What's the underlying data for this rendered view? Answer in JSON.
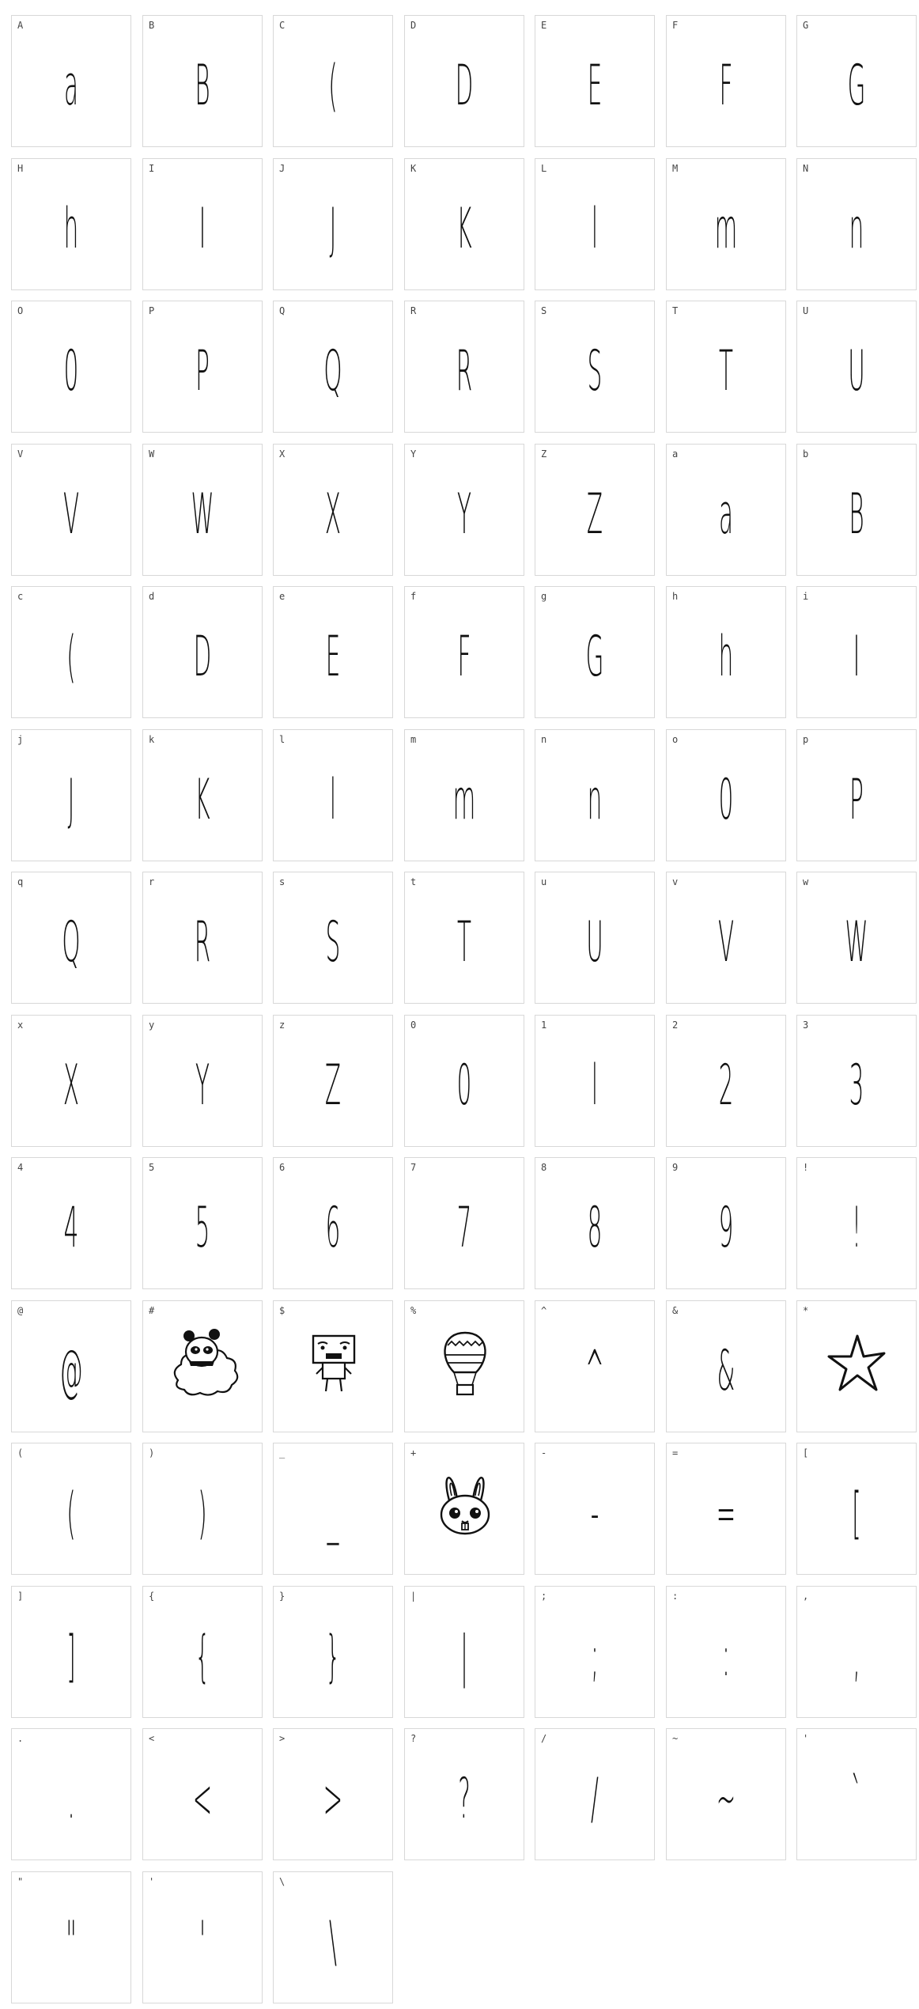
{
  "chars": [
    {
      "label": "A",
      "glyph": "a"
    },
    {
      "label": "B",
      "glyph": "B"
    },
    {
      "label": "C",
      "glyph": "("
    },
    {
      "label": "D",
      "glyph": "D"
    },
    {
      "label": "E",
      "glyph": "E"
    },
    {
      "label": "F",
      "glyph": "F"
    },
    {
      "label": "G",
      "glyph": "G"
    },
    {
      "label": "H",
      "glyph": "h"
    },
    {
      "label": "I",
      "glyph": "I"
    },
    {
      "label": "J",
      "glyph": "J"
    },
    {
      "label": "K",
      "glyph": "K"
    },
    {
      "label": "L",
      "glyph": "l"
    },
    {
      "label": "M",
      "glyph": "m"
    },
    {
      "label": "N",
      "glyph": "n"
    },
    {
      "label": "O",
      "glyph": "0"
    },
    {
      "label": "P",
      "glyph": "P"
    },
    {
      "label": "Q",
      "glyph": "Q"
    },
    {
      "label": "R",
      "glyph": "R"
    },
    {
      "label": "S",
      "glyph": "S"
    },
    {
      "label": "T",
      "glyph": "T"
    },
    {
      "label": "U",
      "glyph": "U"
    },
    {
      "label": "V",
      "glyph": "V"
    },
    {
      "label": "W",
      "glyph": "W"
    },
    {
      "label": "X",
      "glyph": "X"
    },
    {
      "label": "Y",
      "glyph": "Y"
    },
    {
      "label": "Z",
      "glyph": "Z"
    },
    {
      "label": "a",
      "glyph": "a"
    },
    {
      "label": "b",
      "glyph": "B"
    },
    {
      "label": "c",
      "glyph": "("
    },
    {
      "label": "d",
      "glyph": "D"
    },
    {
      "label": "e",
      "glyph": "E"
    },
    {
      "label": "f",
      "glyph": "F"
    },
    {
      "label": "g",
      "glyph": "G"
    },
    {
      "label": "h",
      "glyph": "h"
    },
    {
      "label": "i",
      "glyph": "I"
    },
    {
      "label": "j",
      "glyph": "J"
    },
    {
      "label": "k",
      "glyph": "K"
    },
    {
      "label": "l",
      "glyph": "l"
    },
    {
      "label": "m",
      "glyph": "m"
    },
    {
      "label": "n",
      "glyph": "n"
    },
    {
      "label": "o",
      "glyph": "0"
    },
    {
      "label": "p",
      "glyph": "P"
    },
    {
      "label": "q",
      "glyph": "Q"
    },
    {
      "label": "r",
      "glyph": "R"
    },
    {
      "label": "s",
      "glyph": "S"
    },
    {
      "label": "t",
      "glyph": "T"
    },
    {
      "label": "u",
      "glyph": "U"
    },
    {
      "label": "v",
      "glyph": "V"
    },
    {
      "label": "w",
      "glyph": "W"
    },
    {
      "label": "x",
      "glyph": "X"
    },
    {
      "label": "y",
      "glyph": "Y"
    },
    {
      "label": "z",
      "glyph": "Z"
    },
    {
      "label": "0",
      "glyph": "0"
    },
    {
      "label": "1",
      "glyph": "l"
    },
    {
      "label": "2",
      "glyph": "2"
    },
    {
      "label": "3",
      "glyph": "3"
    },
    {
      "label": "4",
      "glyph": "4"
    },
    {
      "label": "5",
      "glyph": "5"
    },
    {
      "label": "6",
      "glyph": "6"
    },
    {
      "label": "7",
      "glyph": "7"
    },
    {
      "label": "8",
      "glyph": "8"
    },
    {
      "label": "9",
      "glyph": "9"
    },
    {
      "label": "!",
      "glyph": "!"
    },
    {
      "label": "@",
      "glyph": "@"
    },
    {
      "label": "#",
      "picture": "panda-cloud-picture"
    },
    {
      "label": "$",
      "picture": "box-robot-picture"
    },
    {
      "label": "%",
      "picture": "hot-air-balloon-picture"
    },
    {
      "label": "^",
      "glyph": "^"
    },
    {
      "label": "&",
      "glyph": "&"
    },
    {
      "label": "*",
      "picture": "star-picture"
    },
    {
      "label": "(",
      "glyph": "("
    },
    {
      "label": ")",
      "glyph": ")"
    },
    {
      "label": "_",
      "glyph": "_"
    },
    {
      "label": "+",
      "picture": "bunny-face-picture"
    },
    {
      "label": "-",
      "glyph": "-"
    },
    {
      "label": "=",
      "glyph": "="
    },
    {
      "label": "[",
      "glyph": "["
    },
    {
      "label": "]",
      "glyph": "]"
    },
    {
      "label": "{",
      "glyph": "{"
    },
    {
      "label": "}",
      "glyph": "}"
    },
    {
      "label": "|",
      "glyph": "|"
    },
    {
      "label": ";",
      "glyph": ";"
    },
    {
      "label": ":",
      "glyph": ":"
    },
    {
      "label": ",",
      "glyph": ","
    },
    {
      "label": ".",
      "glyph": "."
    },
    {
      "label": "<",
      "glyph": "<"
    },
    {
      "label": ">",
      "glyph": ">"
    },
    {
      "label": "?",
      "glyph": "?"
    },
    {
      "label": "/",
      "glyph": "/"
    },
    {
      "label": "~",
      "glyph": "~"
    },
    {
      "label": "'",
      "glyph": "`"
    },
    {
      "label": "\"",
      "glyph": "\""
    },
    {
      "label": "'",
      "glyph": "'"
    },
    {
      "label": "\\",
      "glyph": "\\"
    }
  ]
}
